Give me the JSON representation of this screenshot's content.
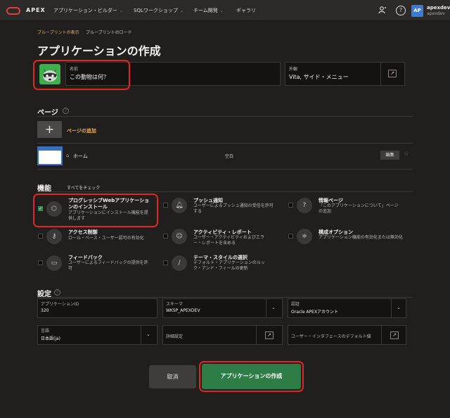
{
  "topbar": {
    "brand": "APEX",
    "nav": [
      {
        "label": "アプリケーション・ビルダー"
      },
      {
        "label": "SQLワークショップ"
      },
      {
        "label": "チーム開発"
      },
      {
        "label": "ギャラリ"
      }
    ],
    "avatar_initials": "AP",
    "user_name": "apexdev",
    "user_workspace": "apexdev"
  },
  "breadcrumb": {
    "link": "ブループリントの表示",
    "current": "ブループリントのロード"
  },
  "page_title": "アプリケーションの作成",
  "name_field": {
    "label": "名前",
    "value": "この動物は何？"
  },
  "appearance_field": {
    "label": "外観",
    "value": "Vita, サイド・メニュー"
  },
  "pages_section": {
    "title": "ページ",
    "add_label": "ページの追加",
    "rows": [
      {
        "name": "ホーム",
        "type": "空白",
        "edit_label": "編集"
      }
    ]
  },
  "features_section": {
    "title": "機能",
    "check_all": "すべてをチェック",
    "items": [
      {
        "title": "プログレッシブWebアプリケーショ",
        "title2": "ンのインストール",
        "desc": "アプリケーションにインストール機能を提供します",
        "checked": true,
        "icon": "box-icon"
      },
      {
        "title": "プッシュ通知",
        "desc": "ユーザーによるプッシュ通知の受信を許可する",
        "checked": false,
        "icon": "bell-icon"
      },
      {
        "title": "情報ページ",
        "desc": "「このアプリケーションについて」ページの追加",
        "checked": false,
        "icon": "info-icon"
      },
      {
        "title": "アクセス制御",
        "desc": "ロール・ベース・ユーザー認可の有効化",
        "checked": false,
        "icon": "key-icon"
      },
      {
        "title": "アクティビティ・レポート",
        "desc": "ユーザー・アクティビティおよびエラー・レポートを含める",
        "checked": false,
        "icon": "user-chart-icon"
      },
      {
        "title": "構成オプション",
        "desc": "アプリケーション機能の有効化または無効化",
        "checked": false,
        "icon": "sliders-icon"
      },
      {
        "title": "フィードバック",
        "desc": "ユーザーによるフィードバックの提供を許可",
        "checked": false,
        "icon": "comment-icon"
      },
      {
        "title": "テーマ・スタイルの選択",
        "desc": "デフォルト・アプリケーションのルック・アンド・フィールの更新",
        "checked": false,
        "icon": "brush-icon"
      }
    ]
  },
  "settings_section": {
    "title": "設定",
    "app_id": {
      "label": "アプリケーションID",
      "value": "320"
    },
    "schema": {
      "label": "スキーマ",
      "value": "WKSP_APEXDEV"
    },
    "auth": {
      "label": "認証",
      "value": "Oracle APEXアカウント"
    },
    "language": {
      "label": "言語",
      "value": "日本語(ja)"
    },
    "advanced": {
      "label": "詳細設定"
    },
    "ui_default": {
      "label": "ユーザー・インタフェースのデフォルト値"
    }
  },
  "buttons": {
    "cancel": "取消",
    "create": "アプリケーションの作成"
  },
  "colors": {
    "accent_green": "#2e7d47",
    "highlight_red": "#e0261d",
    "link_gold": "#e8b450"
  }
}
